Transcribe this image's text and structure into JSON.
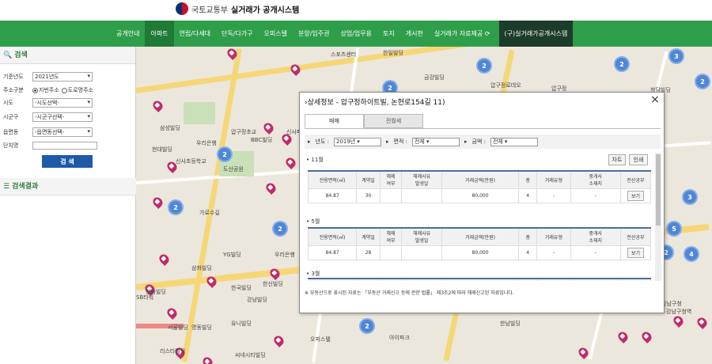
{
  "header": {
    "org_name": "국토교통부",
    "site_name": "실거래가 공개시스템"
  },
  "nav": {
    "items": [
      {
        "label": "공개안내"
      },
      {
        "label": "아파트",
        "active": true
      },
      {
        "label": "연립/다세대"
      },
      {
        "label": "단독/다가구"
      },
      {
        "label": "오피스텔"
      },
      {
        "label": "분양/입주권"
      },
      {
        "label": "상업/업무용"
      },
      {
        "label": "토지"
      },
      {
        "label": "게시판"
      },
      {
        "label": "실거래가 자료제공 ⟳"
      },
      {
        "label": "(구)실거래가공개시스템",
        "dark": true
      }
    ]
  },
  "sidebar": {
    "search_title": "검색",
    "rows": {
      "base_year": {
        "label": "기준년도",
        "value": "2021년도"
      },
      "address_type": {
        "label": "주소구분",
        "option1": "지번주소",
        "option2": "도로명주소"
      },
      "city": {
        "label": "시도",
        "value": "-시도선택-"
      },
      "district": {
        "label": "시군구",
        "value": "-시군구선택-"
      },
      "dong": {
        "label": "읍면동",
        "value": "-읍면동선택-"
      },
      "complex": {
        "label": "단지명",
        "value": ""
      }
    },
    "search_button": "검 색",
    "results_title": "검색결과"
  },
  "map": {
    "clusters": [
      "2",
      "2",
      "3",
      "2",
      "2",
      "2",
      "2",
      "2",
      "3",
      "5",
      "2",
      "4",
      "2"
    ],
    "labels": [
      "스포츠센터",
      "한일빌딩",
      "금강빌딩",
      "압구정로데오",
      "청담빌딩",
      "삼성빌딩",
      "우리은행",
      "신사파출소",
      "압구정초교",
      "BBC빌딩",
      "현대빌딩",
      "신사초등학교",
      "도산공원",
      "가로수길",
      "YG빌딩",
      "우리은행",
      "삼화빌딩",
      "한국빌딩",
      "정음빌딩",
      "강남빌딩",
      "압구정",
      "신사동",
      "한신빌딩",
      "SB타워",
      "서울빌딩",
      "명동빌딩",
      "유니빌딩",
      "리스타빌딩",
      "한남빌딩",
      "강남구청",
      "씨네시티빌딩",
      "오피스텔",
      "아이파크",
      "강남구청역"
    ]
  },
  "popup": {
    "title": "상세정보 - 압구정하이트빌, 논현로154길 11)",
    "close": "×",
    "tabs": [
      "매매",
      "전월세"
    ],
    "filters": {
      "year_label": "년도 :",
      "year_value": "2019년",
      "area_label": "면적 :",
      "area_value": "전체",
      "amount_label": "금액 :",
      "amount_value": "전체"
    },
    "chart_button": "차트",
    "print_button": "인쇄",
    "columns": [
      "전용면적(㎡)",
      "계약일",
      "해제\n여부",
      "해제사유\n발생일",
      "거래금액(만원)",
      "층",
      "거래유형",
      "중개사\n소재지",
      "전산공부"
    ],
    "sections": [
      {
        "month": "11월",
        "rows": [
          {
            "area": "84.87",
            "day": "30",
            "cancel": "",
            "cancel_date": "",
            "price": "80,000",
            "floor": "4",
            "type": "-",
            "agent": "-",
            "ledger": "보기"
          }
        ]
      },
      {
        "month": "5월",
        "rows": [
          {
            "area": "84.87",
            "day": "28",
            "cancel": "",
            "cancel_date": "",
            "price": "80,000",
            "floor": "4",
            "type": "-",
            "agent": "-",
            "ledger": "보기"
          }
        ]
      },
      {
        "month": "3월",
        "rows": []
      }
    ],
    "notice": "※ 부동산으로 표시된 자료는 「부동산 거래신고 등에 관한 법률」 제3조2에 따라 해제신고된 자료입니다."
  }
}
